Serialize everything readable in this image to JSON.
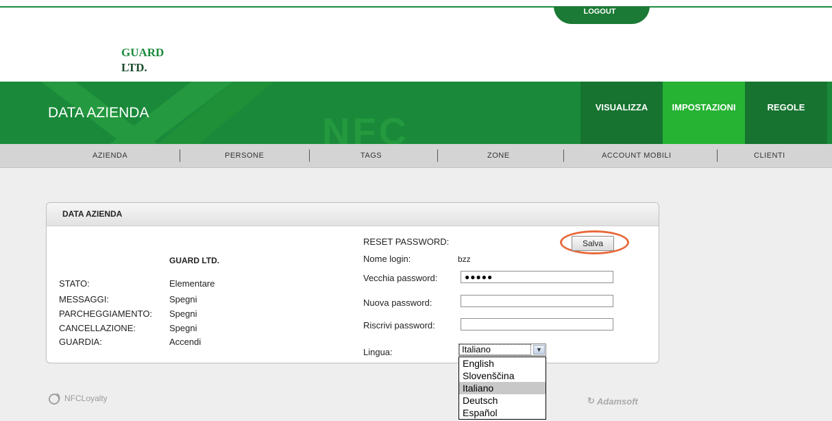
{
  "top": {
    "logout": "LOGOUT",
    "brand_line1": "GUARD",
    "brand_line2": "LTD."
  },
  "header": {
    "title": "DATA AZIENDA",
    "watermark": "NFC",
    "nav": [
      "VISUALIZZA",
      "IMPOSTAZIONI",
      "REGOLE"
    ],
    "active_nav": "IMPOSTAZIONI"
  },
  "submenu": [
    "AZIENDA",
    "PERSONE",
    "TAGS",
    "ZONE",
    "ACCOUNT MOBILI",
    "CLIENTI"
  ],
  "panel": {
    "title": "DATA AZIENDA",
    "company": "GUARD LTD.",
    "info": [
      {
        "label": "STATO:",
        "value": "Elementare"
      },
      {
        "label": "MESSAGGI:",
        "value": "Spegni"
      },
      {
        "label": "PARCHEGGIAMENTO:",
        "value": "Spegni"
      },
      {
        "label": "CANCELLAZIONE:",
        "value": "Spegni"
      },
      {
        "label": "GUARDIA:",
        "value": "Accendi"
      }
    ],
    "reset_title": "RESET PASSWORD:",
    "save_label": "Salva",
    "login_label": "Nome login:",
    "login_value": "bzz",
    "old_pw_label": "Vecchia password:",
    "old_pw_value": "●●●●●",
    "new_pw_label": "Nuova password:",
    "new_pw_value": "",
    "repeat_pw_label": "Riscrivi password:",
    "repeat_pw_value": "",
    "lang_label": "Lingua:",
    "lang_selected": "Italiano",
    "lang_options": [
      "English",
      "Slovenščina",
      "Italiano",
      "Deutsch",
      "Español"
    ]
  },
  "footer": {
    "left_logo": "NFCLoyalty",
    "right_logo": "Adamsoft"
  },
  "colors": {
    "green": "#1a8a3a",
    "green_dark": "#167330",
    "green_active": "#26b233",
    "highlight_ring": "#e8693a"
  }
}
